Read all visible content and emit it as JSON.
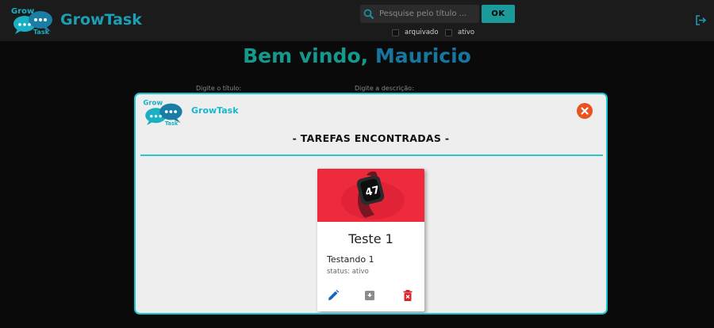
{
  "header": {
    "brand_top": "Grow",
    "brand_bottom": "Task",
    "app_title": "GrowTask",
    "search": {
      "placeholder": "Pesquise pelo título ...",
      "value": ""
    },
    "ok_label": "OK",
    "filters": [
      {
        "label": "arquivado",
        "checked": false
      },
      {
        "label": "ativo",
        "checked": false
      }
    ]
  },
  "page": {
    "welcome_prefix": "Bem vindo,",
    "welcome_name": "Mauricio",
    "title_hint": "Digite o título:",
    "description_hint": "Digite a descrição:"
  },
  "modal": {
    "brand": "GrowTask",
    "heading": "- TAREFAS ENCONTRADAS -",
    "tasks": [
      {
        "title": "Teste 1",
        "description": "Testando 1",
        "status_label": "status:",
        "status_value": "ativo",
        "badge_text": "47"
      }
    ]
  },
  "colors": {
    "accent": "#1cc5cf",
    "ok_button": "#1a9a9a",
    "close": "#e8531f",
    "edit_icon": "#1565c0",
    "delete_icon": "#d9232d",
    "card_media": "#ee2a3d"
  },
  "icons": {
    "search": "search-icon",
    "logout": "logout-icon",
    "close": "close-icon",
    "edit": "pencil-icon",
    "archive": "archive-icon",
    "delete": "trash-icon"
  }
}
